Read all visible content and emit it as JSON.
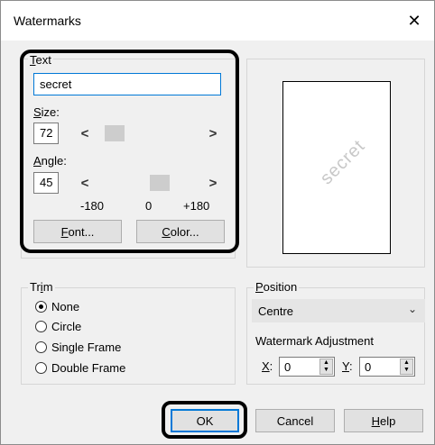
{
  "window": {
    "title": "Watermarks",
    "close_glyph": "✕"
  },
  "text_group": {
    "label_prefix": "T",
    "label_rest": "ext",
    "text_value": "secret",
    "size_label_prefix": "S",
    "size_label_rest": "ize:",
    "size_value": "72",
    "angle_label_prefix": "A",
    "angle_label_rest": "ngle:",
    "angle_value": "45",
    "angle_min": "-180",
    "angle_mid": "0",
    "angle_max": "+180",
    "font_button_prefix": "F",
    "font_button_rest": "ont...",
    "color_button_prefix": "C",
    "color_button_rest": "olor...",
    "scroll_left": "<",
    "scroll_right": ">"
  },
  "preview": {
    "watermark_text": "secret"
  },
  "trim": {
    "label_prefix": "Tr",
    "label_u": "i",
    "label_rest": "m",
    "options": [
      {
        "label": "None",
        "selected": true
      },
      {
        "label": "Circle",
        "selected": false
      },
      {
        "label": "Single Frame",
        "selected": false
      },
      {
        "label": "Double Frame",
        "selected": false
      }
    ]
  },
  "position": {
    "label_prefix": "P",
    "label_rest": "osition",
    "selected": "Centre",
    "adjustment_label": "Watermark Adjustment",
    "x_label": "X",
    "x_value": "0",
    "y_label": "Y",
    "y_value": "0"
  },
  "buttons": {
    "ok": "OK",
    "cancel": "Cancel",
    "help_prefix": "H",
    "help_rest": "elp"
  },
  "colors": {
    "accent": "#0078d7",
    "highlight": "#000000",
    "watermark": "#c8c8c8"
  }
}
